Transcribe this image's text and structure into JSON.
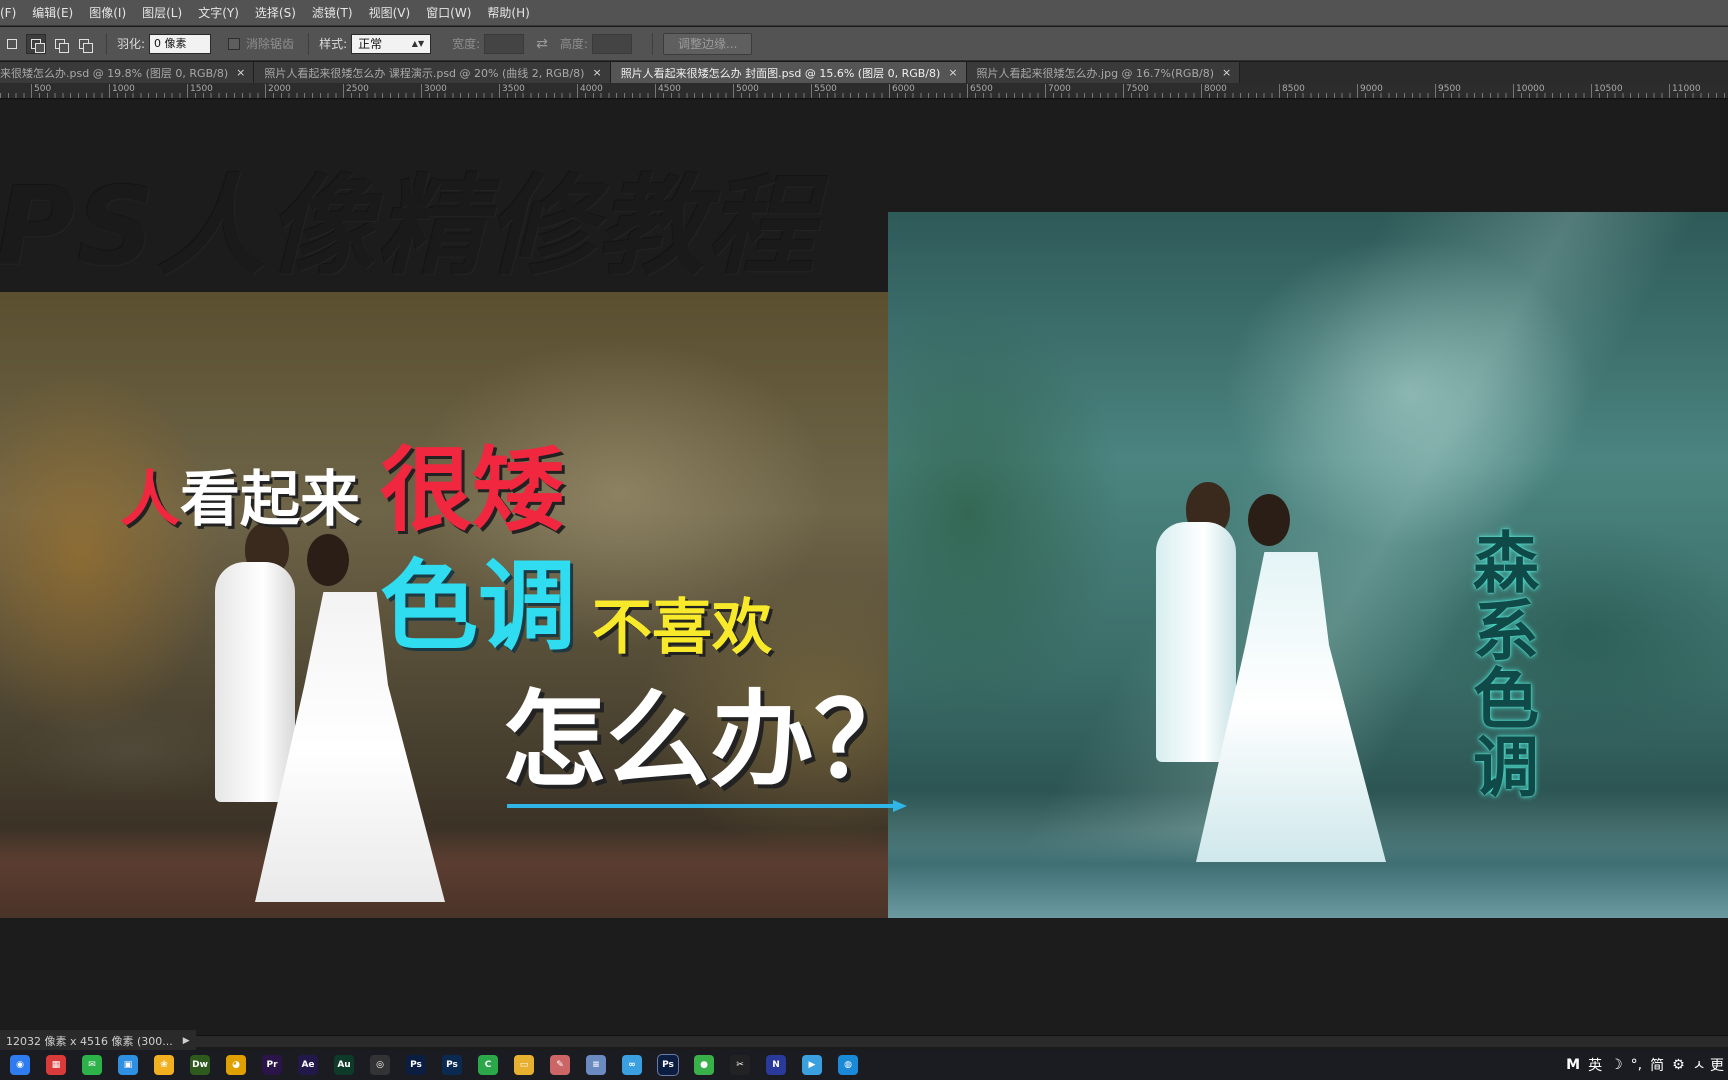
{
  "menu": [
    "(F)",
    "编辑(E)",
    "图像(I)",
    "图层(L)",
    "文字(Y)",
    "选择(S)",
    "滤镜(T)",
    "视图(V)",
    "窗口(W)",
    "帮助(H)"
  ],
  "options": {
    "feather_label": "羽化:",
    "feather_value": "0 像素",
    "antialias_label": "消除锯齿",
    "style_label": "样式:",
    "style_value": "正常",
    "width_label": "宽度:",
    "height_label": "高度:",
    "refine_edge": "调整边缘..."
  },
  "tabs": [
    {
      "label": "来很矮怎么办.psd @ 19.8% (图层 0, RGB/8)",
      "active": false
    },
    {
      "label": "照片人看起来很矮怎么办 课程演示.psd @ 20% (曲线 2, RGB/8)",
      "active": false
    },
    {
      "label": "照片人看起来很矮怎么办 封面图.psd @ 15.6% (图层 0, RGB/8)",
      "active": true
    },
    {
      "label": "照片人看起来很矮怎么办.jpg @ 16.7%(RGB/8)",
      "active": false
    }
  ],
  "tab_close_glyph": "×",
  "ruler_labels": [
    "500",
    "1000",
    "1500",
    "2000",
    "2500",
    "3000",
    "3500",
    "4000",
    "4500",
    "5000",
    "5500",
    "6000",
    "6500",
    "7000",
    "7500",
    "8000",
    "8500",
    "9000",
    "9500",
    "10000",
    "10500",
    "11000"
  ],
  "canvas": {
    "heading": "PS人像精修教程",
    "line_short_red": "人",
    "line_short_white": "看起来",
    "line_short_big": "很矮",
    "line_tone": "色调",
    "line_dislike": "不喜欢",
    "line_how": "怎么办？",
    "vertical_tag": "森系色调"
  },
  "status": {
    "doc_size": "12032 像素 x 4516 像素 (300...",
    "arrow_glyph": "▶"
  },
  "taskbar": [
    {
      "name": "baidu-netdisk-icon",
      "glyph": "◉",
      "color": "#2f7cf0"
    },
    {
      "name": "news-icon",
      "glyph": "▦",
      "color": "#d93a3a"
    },
    {
      "name": "wechat-icon",
      "glyph": "✉",
      "color": "#2db24a"
    },
    {
      "name": "bag-icon",
      "glyph": "▣",
      "color": "#2f8fe0"
    },
    {
      "name": "photos-icon",
      "glyph": "❀",
      "color": "#f0b020"
    },
    {
      "name": "dreamweaver-icon",
      "glyph": "Dw",
      "color": "#2f5a1e"
    },
    {
      "name": "chrome-icon",
      "glyph": "◕",
      "color": "#e0a000"
    },
    {
      "name": "premiere-icon",
      "glyph": "Pr",
      "color": "#2a1448"
    },
    {
      "name": "after-effects-icon",
      "glyph": "Ae",
      "color": "#22184a"
    },
    {
      "name": "audition-icon",
      "glyph": "Au",
      "color": "#0e3a2a"
    },
    {
      "name": "aperture-icon",
      "glyph": "◎",
      "color": "#333333"
    },
    {
      "name": "photoshop-icon",
      "glyph": "Ps",
      "color": "#0b1e42"
    },
    {
      "name": "photoshop-alt-icon",
      "glyph": "Ps",
      "color": "#0b2a52"
    },
    {
      "name": "camtasia-icon",
      "glyph": "C",
      "color": "#2aa84a"
    },
    {
      "name": "folder-icon",
      "glyph": "▭",
      "color": "#e8b030"
    },
    {
      "name": "paint-icon",
      "glyph": "✎",
      "color": "#cc6666"
    },
    {
      "name": "notepad-icon",
      "glyph": "≡",
      "color": "#6a8ac0"
    },
    {
      "name": "glasses-icon",
      "glyph": "∞",
      "color": "#3aa0e0"
    },
    {
      "name": "photoshop-active-icon",
      "glyph": "Ps",
      "color": "#0b1e42",
      "active": true
    },
    {
      "name": "green-ball-icon",
      "glyph": "●",
      "color": "#3ab04a"
    },
    {
      "name": "capcut-icon",
      "glyph": "✂",
      "color": "#222222"
    },
    {
      "name": "n-app-icon",
      "glyph": "N",
      "color": "#2a3a9a"
    },
    {
      "name": "play-icon",
      "glyph": "▶",
      "color": "#3aa0e0"
    },
    {
      "name": "browser-icon",
      "glyph": "◍",
      "color": "#1a8ad8"
    }
  ],
  "tray": {
    "ime_logo": "M",
    "lang": "英",
    "moon": "☽",
    "punct": "°,",
    "simplified": "简",
    "settings": "⚙",
    "extra": "ㅅ 更"
  }
}
